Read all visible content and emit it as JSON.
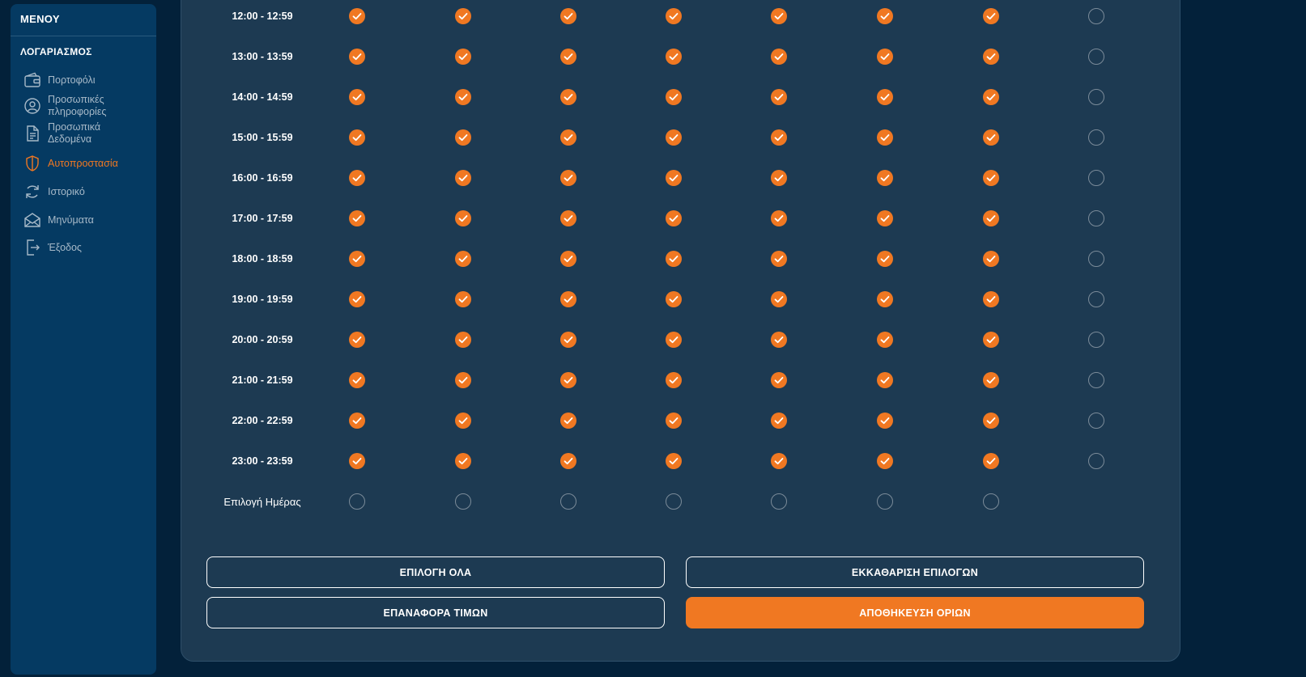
{
  "sidebar": {
    "menu_title": "ΜΕΝΟΥ",
    "section_title": "ΛΟΓΑΡΙΑΣΜΟΣ",
    "items": [
      {
        "label": "Πορτοφόλι",
        "icon": "wallet-icon"
      },
      {
        "label": "Προσωπικές πληροφορίες",
        "icon": "user-circle-icon"
      },
      {
        "label": "Προσωπικά Δεδομένα",
        "icon": "document-icon"
      },
      {
        "label": "Αυτοπροστασία",
        "icon": "shield-icon",
        "active": true
      },
      {
        "label": "Ιστορικό",
        "icon": "history-icon"
      },
      {
        "label": "Μηνύματα",
        "icon": "envelope-icon"
      },
      {
        "label": "Έξοδος",
        "icon": "logout-icon"
      }
    ]
  },
  "schedule": {
    "rows": [
      {
        "label": "12:00 - 12:59",
        "checks": [
          true,
          true,
          true,
          true,
          true,
          true,
          true,
          false
        ]
      },
      {
        "label": "13:00 - 13:59",
        "checks": [
          true,
          true,
          true,
          true,
          true,
          true,
          true,
          false
        ]
      },
      {
        "label": "14:00 - 14:59",
        "checks": [
          true,
          true,
          true,
          true,
          true,
          true,
          true,
          false
        ]
      },
      {
        "label": "15:00 - 15:59",
        "checks": [
          true,
          true,
          true,
          true,
          true,
          true,
          true,
          false
        ]
      },
      {
        "label": "16:00 - 16:59",
        "checks": [
          true,
          true,
          true,
          true,
          true,
          true,
          true,
          false
        ]
      },
      {
        "label": "17:00 - 17:59",
        "checks": [
          true,
          true,
          true,
          true,
          true,
          true,
          true,
          false
        ]
      },
      {
        "label": "18:00 - 18:59",
        "checks": [
          true,
          true,
          true,
          true,
          true,
          true,
          true,
          false
        ]
      },
      {
        "label": "19:00 - 19:59",
        "checks": [
          true,
          true,
          true,
          true,
          true,
          true,
          true,
          false
        ]
      },
      {
        "label": "20:00 - 20:59",
        "checks": [
          true,
          true,
          true,
          true,
          true,
          true,
          true,
          false
        ]
      },
      {
        "label": "21:00 - 21:59",
        "checks": [
          true,
          true,
          true,
          true,
          true,
          true,
          true,
          false
        ]
      },
      {
        "label": "22:00 - 22:59",
        "checks": [
          true,
          true,
          true,
          true,
          true,
          true,
          true,
          false
        ]
      },
      {
        "label": "23:00 - 23:59",
        "checks": [
          true,
          true,
          true,
          true,
          true,
          true,
          true,
          false
        ]
      }
    ],
    "day_select": {
      "label": "Επιλογή Ημέρας",
      "checks": [
        false,
        false,
        false,
        false,
        false,
        false,
        false
      ]
    }
  },
  "buttons": {
    "select_all": "ΕΠΙΛΟΓΗ ΟΛΑ",
    "clear": "ΕΚΚΑΘΑΡΙΣΗ ΕΠΙΛΟΓΩΝ",
    "reset": "ΕΠΑΝΑΦΟΡΑ ΤΙΜΩΝ",
    "save": "ΑΠΟΘΗΚΕΥΣΗ ΟΡΙΩΝ"
  },
  "colors": {
    "accent": "#f07822",
    "page_bg": "#03213a",
    "sidebar_bg": "#053a62",
    "panel_bg": "#1d3a52"
  }
}
